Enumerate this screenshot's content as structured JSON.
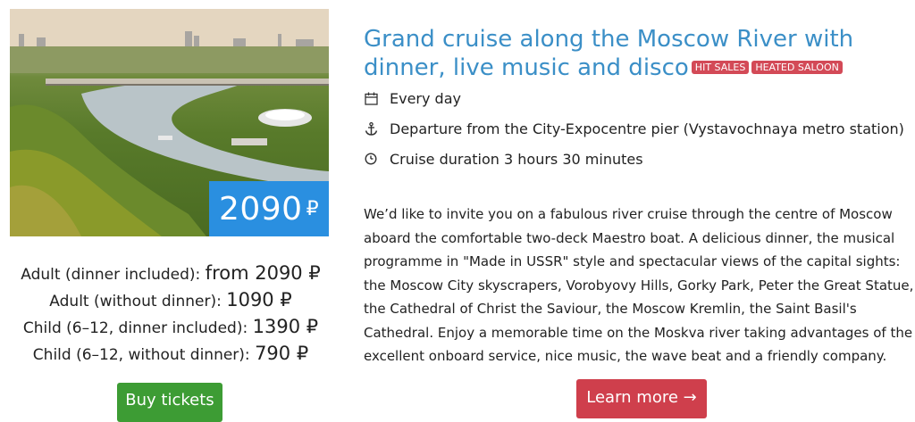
{
  "cruise": {
    "price_badge": {
      "amount": "2090",
      "currency": "₽"
    },
    "prices": [
      {
        "label": "Adult (dinner included): ",
        "value": "from 2090 ₽"
      },
      {
        "label": "Adult (without dinner): ",
        "value": "1090 ₽"
      },
      {
        "label": "Child (6–12, dinner included): ",
        "value": "1390 ₽"
      },
      {
        "label": "Child (6–12, without dinner): ",
        "value": "790 ₽"
      }
    ],
    "buy_label": "Buy tickets",
    "title": "Grand cruise along the Moscow River with dinner, live music and disco",
    "badges": [
      "HIT SALES",
      "HEATED SALOON"
    ],
    "facts": [
      {
        "icon": "calendar-icon",
        "text": "Every day"
      },
      {
        "icon": "anchor-icon",
        "text": "Departure from the City-Expocentre pier (Vystavochnaya metro station)"
      },
      {
        "icon": "clock-icon",
        "text": "Cruise duration 3 hours 30 minutes"
      }
    ],
    "description": "We’d like to invite you on a fabulous river cruise through the centre of Moscow aboard the comfortable two-deck Maestro boat. A delicious dinner, the musical programme in \"Made in USSR\" style and spectacular views of the capital sights: the Moscow City skyscrapers, Vorobyovy Hills, Gorky Park, Peter the Great Statue, the Cathedral of Christ the Saviour, the Moscow Kremlin, the Saint Basil's Cathedral. Enjoy a memorable time on the Moskva river taking advantages of the excellent onboard service, nice music, the wave beat and a friendly company.",
    "learn_label": "Learn more →"
  },
  "colors": {
    "title": "#3b8fc7",
    "badge": "#d34a57",
    "price_badge_bg": "#2a8fe0",
    "buy_button": "#3d9c34",
    "learn_button": "#cf3f4c"
  }
}
